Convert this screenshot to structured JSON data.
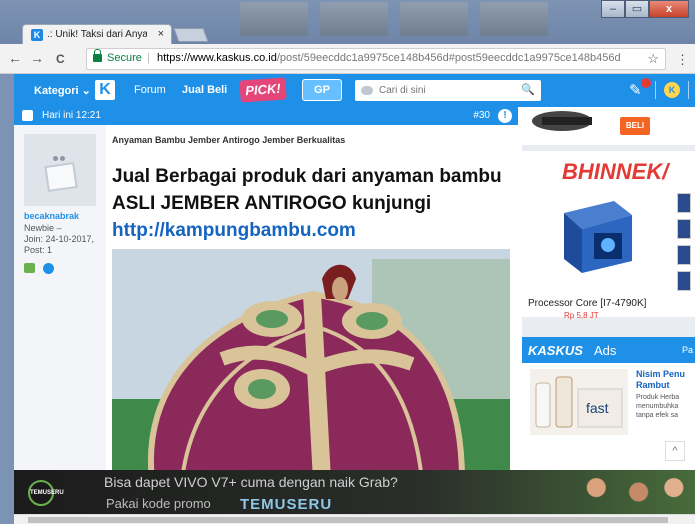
{
  "browser": {
    "tab_title": ".: Unik! Taksi dari Anyam",
    "tab_close": "×",
    "secure_label": "Secure",
    "url_host": "https://www.kaskus.co.id",
    "url_rest": "/post/59eecddc1a9975ce148b456d#post59eecddc1a9975ce148b456d",
    "star": "☆",
    "back": "←",
    "forward": "→",
    "reload": "C",
    "menu": "⋮",
    "window_minimize": "–",
    "window_maximize": "▭",
    "window_close": "x"
  },
  "nav": {
    "kategori": "Kategori ⌄",
    "logo": "K",
    "forum": "Forum",
    "jual_beli": "Jual Beli",
    "pick": "PICK!",
    "gp": "GP",
    "search_placeholder": "Cari di sini",
    "search_icon": "🔍",
    "coin": "K"
  },
  "post": {
    "date": "Hari ini 12:21",
    "number": "#30",
    "info": "!",
    "subject": "Anyaman Bambu Jember Antirogo Jember Berkualitas",
    "headline": "Jual Berbagai produk dari anyaman bambu ASLI JEMBER ANTIROGO kunjungi ",
    "headline_link": "http://kampungbambu.com"
  },
  "user": {
    "username": "becaknabrak",
    "rank": "Newbie –",
    "joined": "Join: 24-10-2017,",
    "posts": "Post: 1"
  },
  "sidebar": {
    "beli": "BELI",
    "bhinneka": "BHINNEK/",
    "product_title": "Processor Core [I7-4790K]",
    "product_price": "Rp 5,8 JT",
    "ads_brand": "KASKUS",
    "ads_label": "Ads",
    "ads_more": "Pa",
    "ad_title": "Nisim Penu Rambut",
    "ad_desc": "Produk Herba menumbuhka tanpa efek sa",
    "ad_fast": "fast",
    "scroll_up": "^"
  },
  "banner": {
    "logo": "TEMUSERU",
    "text1": "Bisa dapet VIVO V7+ cuma dengan naik Grab?",
    "text2": "Pakai kode promo",
    "brand": "TEMUSERU"
  },
  "colors": {
    "kaskus_blue": "#1f90e8",
    "bhinneka_red": "#e53935",
    "beli_orange": "#f26522"
  }
}
